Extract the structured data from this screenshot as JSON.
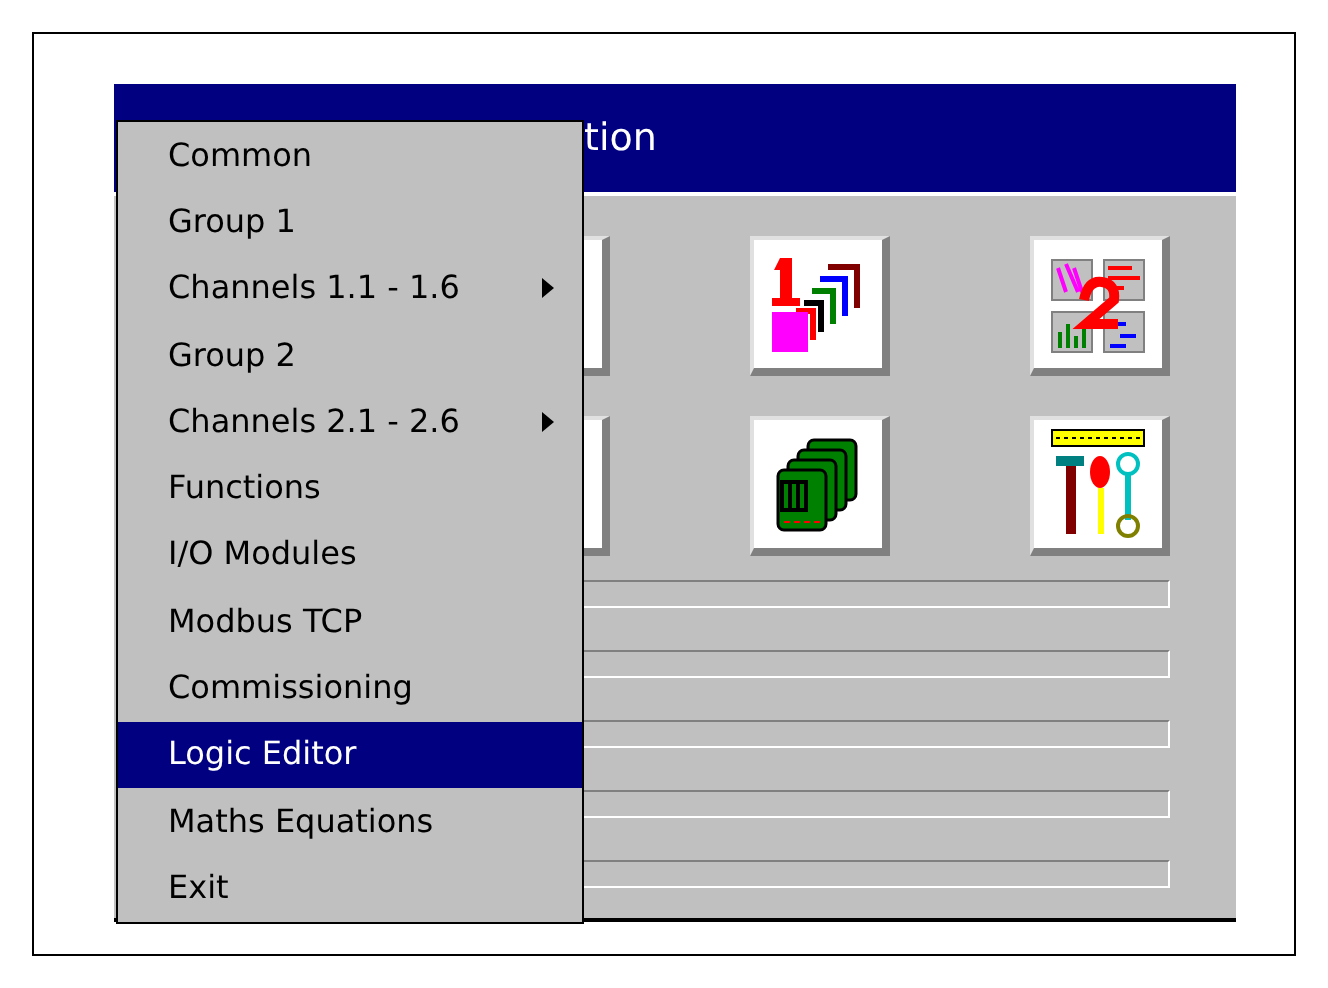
{
  "window": {
    "title": "tion"
  },
  "tiles": [
    {
      "kind": "hidden"
    },
    {
      "kind": "groups"
    },
    {
      "kind": "screens"
    },
    {
      "kind": "hidden"
    },
    {
      "kind": "modules"
    },
    {
      "kind": "tools"
    }
  ],
  "bars": [
    {
      "level": 0
    },
    {
      "level": 0
    },
    {
      "level": 0
    },
    {
      "level": 0
    },
    {
      "level": 0
    }
  ],
  "menu": [
    {
      "label": "Common",
      "submenu": false,
      "selected": false
    },
    {
      "label": "Group 1",
      "submenu": false,
      "selected": false
    },
    {
      "label": "Channels 1.1 - 1.6",
      "submenu": true,
      "selected": false
    },
    {
      "label": "Group 2",
      "submenu": false,
      "selected": false
    },
    {
      "label": "Channels 2.1 - 2.6",
      "submenu": true,
      "selected": false
    },
    {
      "label": "Functions",
      "submenu": false,
      "selected": false
    },
    {
      "label": "I/O Modules",
      "submenu": false,
      "selected": false
    },
    {
      "label": "Modbus TCP",
      "submenu": false,
      "selected": false
    },
    {
      "label": "Commissioning",
      "submenu": false,
      "selected": false
    },
    {
      "label": "Logic Editor",
      "submenu": false,
      "selected": true
    },
    {
      "label": "Maths Equations",
      "submenu": false,
      "selected": false
    },
    {
      "label": "Exit",
      "submenu": false,
      "selected": false
    }
  ]
}
